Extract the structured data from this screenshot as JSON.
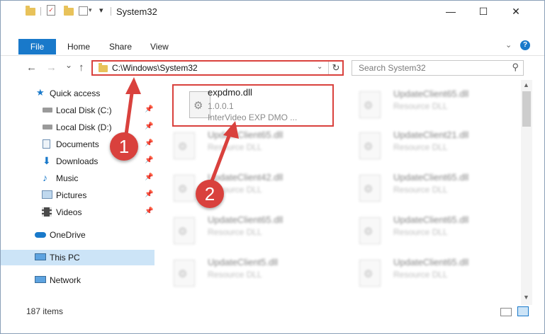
{
  "window": {
    "title": "System32",
    "minimize_glyph": "—",
    "maximize_glyph": "☐",
    "close_glyph": "✕"
  },
  "ribbon": {
    "tabs": [
      "File",
      "Home",
      "Share",
      "View"
    ]
  },
  "nav": {
    "back_glyph": "←",
    "forward_glyph": "→",
    "recent_glyph": "⌄",
    "up_glyph": "↑",
    "address": "C:\\Windows\\System32",
    "address_dropdown_glyph": "⌄",
    "refresh_glyph": "↻",
    "search_placeholder": "Search System32",
    "search_glyph": "⚲"
  },
  "sidebar": {
    "items": [
      {
        "label": "Quick access",
        "icon": "star-icon"
      },
      {
        "label": "Local Disk (C:)",
        "icon": "drive-icon",
        "pinned": true
      },
      {
        "label": "Local Disk (D:)",
        "icon": "drive-icon",
        "pinned": true
      },
      {
        "label": "Documents",
        "icon": "documents-icon",
        "pinned": true
      },
      {
        "label": "Downloads",
        "icon": "downloads-icon",
        "pinned": true
      },
      {
        "label": "Music",
        "icon": "music-icon",
        "pinned": true
      },
      {
        "label": "Pictures",
        "icon": "pictures-icon",
        "pinned": true
      },
      {
        "label": "Videos",
        "icon": "videos-icon",
        "pinned": true
      },
      {
        "label": "OneDrive",
        "icon": "onedrive-icon"
      },
      {
        "label": "This PC",
        "icon": "computer-icon",
        "selected": true
      },
      {
        "label": "Network",
        "icon": "network-icon"
      }
    ]
  },
  "files": [
    {
      "name": "expdmo.dll",
      "version": "1.0.0.1",
      "description": "InterVideo EXP DMO ..."
    },
    {
      "name": "UpdateClient65.dll",
      "description": "Resource DLL"
    },
    {
      "name": "UpdateClient65.dll",
      "description": "Resource DLL"
    },
    {
      "name": "UpdateClient21.dll",
      "description": "Resource DLL"
    },
    {
      "name": "UpdateClient42.dll",
      "description": "Resource DLL"
    },
    {
      "name": "UpdateClient65.dll",
      "description": "Resource DLL"
    },
    {
      "name": "UpdateClient65.dll",
      "description": "Resource DLL"
    },
    {
      "name": "UpdateClient65.dll",
      "description": "Resource DLL"
    },
    {
      "name": "UpdateClient5.dll",
      "description": "Resource DLL"
    },
    {
      "name": "UpdateClient65.dll",
      "description": "Resource DLL"
    }
  ],
  "status": {
    "item_count": "187 items"
  },
  "annotations": {
    "step1": "1",
    "step2": "2"
  },
  "colors": {
    "accent": "#1979ca",
    "annotation_red": "#d9413d",
    "selection": "#cce4f7"
  }
}
